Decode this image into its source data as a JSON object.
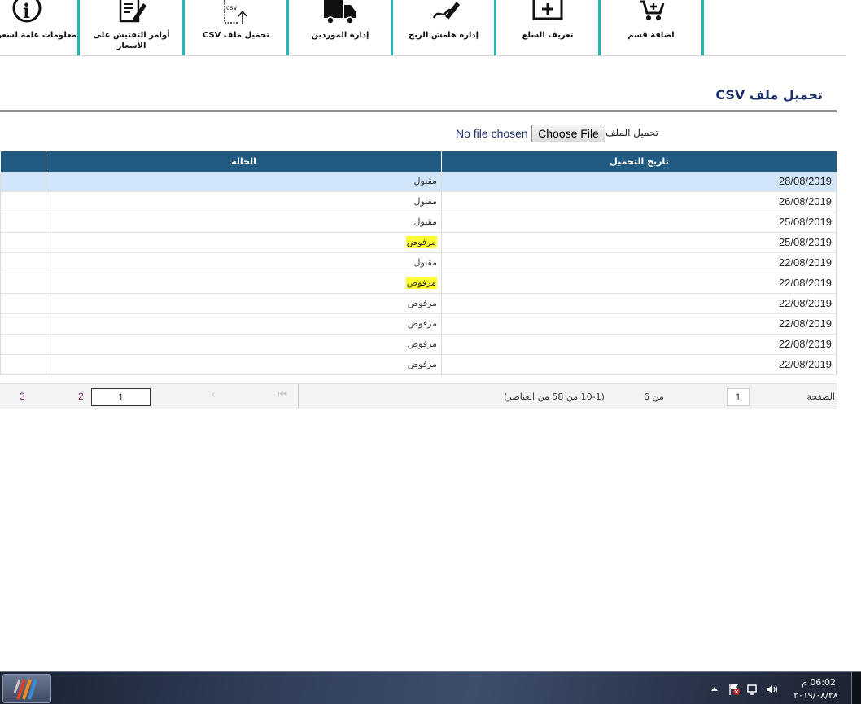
{
  "toolbar": {
    "items": [
      {
        "label": "اضافة قسم",
        "icon": "cart-add-icon"
      },
      {
        "label": "تعريف السلع",
        "icon": "box-plus-icon"
      },
      {
        "label": "إدارة هامش الربح",
        "icon": "pen-sign-icon"
      },
      {
        "label": "إدارة الموردين",
        "icon": "truck-icon"
      },
      {
        "label": "تحميل ملف CSV",
        "icon": "csv-upload-icon",
        "icon_text": "csv"
      },
      {
        "label": "أوامر التفتيش على الأسعار",
        "icon": "edit-document-icon"
      },
      {
        "label": "معلومات عامة لسعر",
        "icon": "info-circle-icon",
        "icon_text": "i"
      }
    ],
    "accent_color": "#26b6b6"
  },
  "section": {
    "title": "تحميل ملف CSV"
  },
  "upload": {
    "label": "تحميل الملف",
    "button_label": "Choose File",
    "status": "No file chosen"
  },
  "table": {
    "columns": [
      "تاريخ التحميل",
      "الحالة"
    ],
    "header_color": "#215b81",
    "rows": [
      {
        "date": "28/08/2019",
        "status": "مقبول",
        "highlight": false,
        "selected": true
      },
      {
        "date": "26/08/2019",
        "status": "مقبول",
        "highlight": false,
        "selected": false
      },
      {
        "date": "25/08/2019",
        "status": "مقبول",
        "highlight": false,
        "selected": false
      },
      {
        "date": "25/08/2019",
        "status": "مرفوض",
        "highlight": true,
        "selected": false
      },
      {
        "date": "22/08/2019",
        "status": "مقبول",
        "highlight": false,
        "selected": false
      },
      {
        "date": "22/08/2019",
        "status": "مرفوض",
        "highlight": true,
        "selected": false
      },
      {
        "date": "22/08/2019",
        "status": "مرفوض",
        "highlight": false,
        "selected": false
      },
      {
        "date": "22/08/2019",
        "status": "مرفوض",
        "highlight": false,
        "selected": false
      },
      {
        "date": "22/08/2019",
        "status": "مرفوض",
        "highlight": false,
        "selected": false
      },
      {
        "date": "22/08/2019",
        "status": "مرفوض",
        "highlight": false,
        "selected": false
      }
    ]
  },
  "pager": {
    "page_word": "الصفحة",
    "page_value": "1",
    "page_of": "من 6",
    "items_info": "(10-1 من 58 من العناصر)",
    "first_symbol": "⏮",
    "prev_symbol": "‹",
    "current_page": "1",
    "page2": "2",
    "page3": "3"
  },
  "taskbar": {
    "time": "06:02 م",
    "date": "٢٠١٩/٠٨/٢٨"
  }
}
